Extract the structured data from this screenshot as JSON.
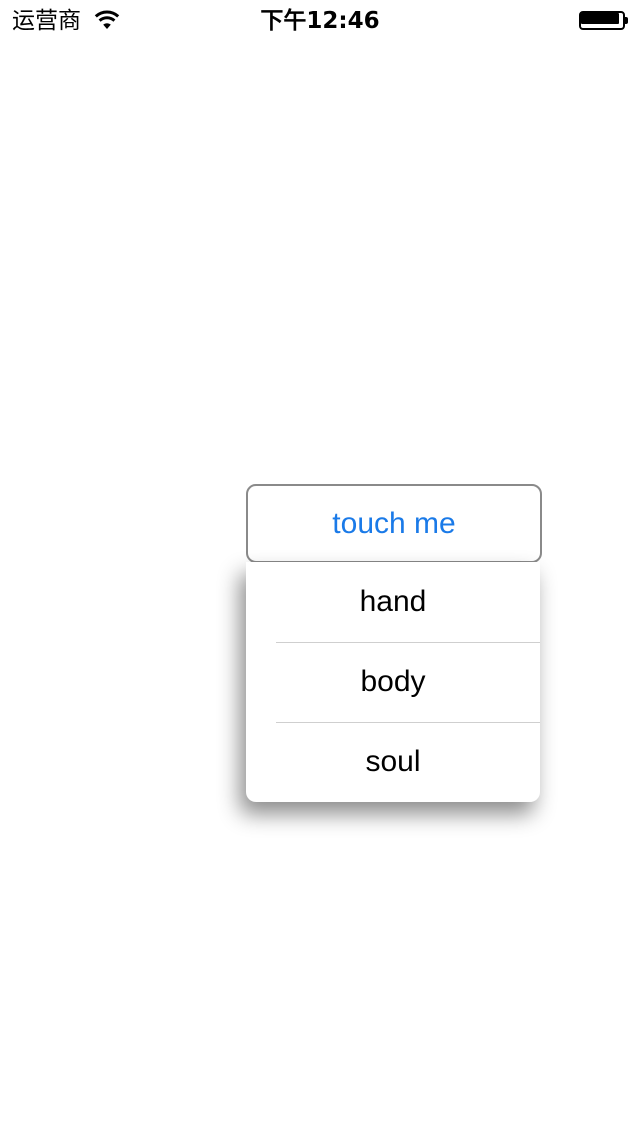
{
  "status_bar": {
    "carrier": "运营商",
    "time": "下午12:46",
    "wifi_icon": "wifi-icon",
    "battery_icon": "battery-full-icon",
    "battery_level": 1.0
  },
  "button": {
    "label": "touch me",
    "color": "#1a7ae8"
  },
  "menu": {
    "items": [
      {
        "label": "hand"
      },
      {
        "label": "body"
      },
      {
        "label": "soul"
      }
    ]
  }
}
